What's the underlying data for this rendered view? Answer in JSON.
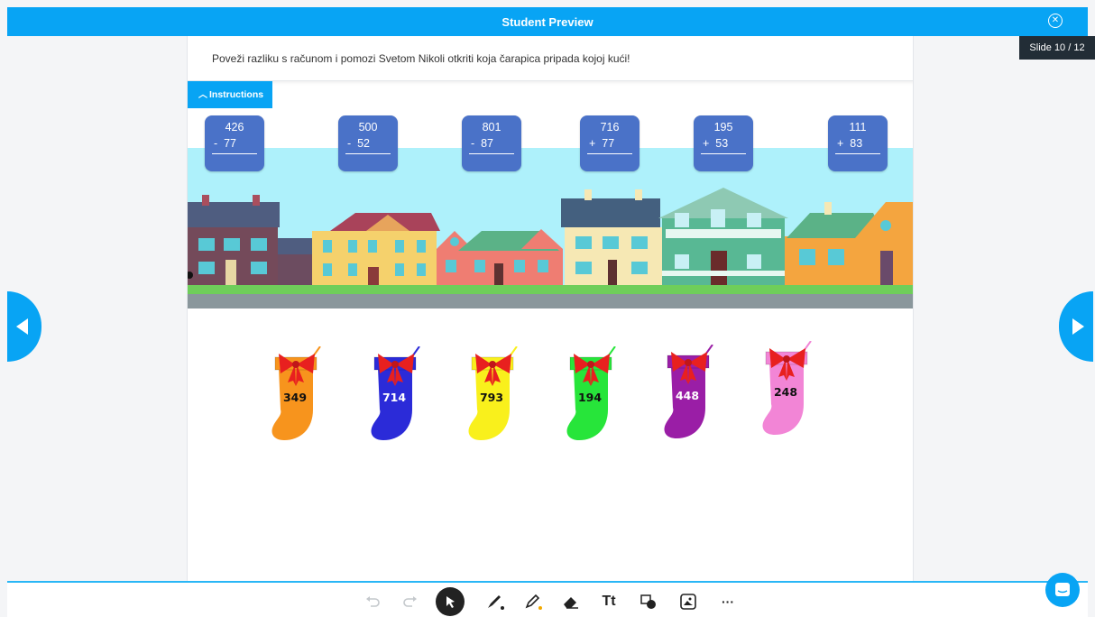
{
  "topbar": {
    "title": "Student Preview",
    "close_icon": "close-circle-icon"
  },
  "slide": {
    "indicator": "Slide 10 / 12"
  },
  "question": {
    "text": "Poveži razliku s računom i pomozi Svetom Nikoli otkriti koja čarapica pripada kojoj kući!"
  },
  "instructions": {
    "label": "Instructions",
    "icon": "chevron-up-icon"
  },
  "problems": [
    {
      "top": "426",
      "op": "-",
      "bottom": "77"
    },
    {
      "top": "500",
      "op": "-",
      "bottom": "52"
    },
    {
      "top": "801",
      "op": "-",
      "bottom": "87"
    },
    {
      "top": "716",
      "op": "+",
      "bottom": "77"
    },
    {
      "top": "195",
      "op": "+",
      "bottom": "53"
    },
    {
      "top": "111",
      "op": "+",
      "bottom": "83"
    }
  ],
  "stockings": [
    {
      "value": "349",
      "color": "#f7941d"
    },
    {
      "value": "714",
      "color": "#2b2bd8"
    },
    {
      "value": "793",
      "color": "#f9f01c"
    },
    {
      "value": "194",
      "color": "#27e53a"
    },
    {
      "value": "448",
      "color": "#9a1ea6"
    },
    {
      "value": "248",
      "color": "#f285d6"
    }
  ],
  "colors": {
    "accent": "#08a4f4",
    "bow": "#e8201f",
    "card": "#4a72c8"
  },
  "toolbar": {
    "tools": [
      "undo-icon",
      "redo-icon",
      "select-icon",
      "pen-icon",
      "highlighter-icon",
      "eraser-icon",
      "text-icon",
      "shapes-icon",
      "image-icon",
      "more-icon"
    ],
    "text_tool_label": "Tt",
    "more_label": "···"
  }
}
